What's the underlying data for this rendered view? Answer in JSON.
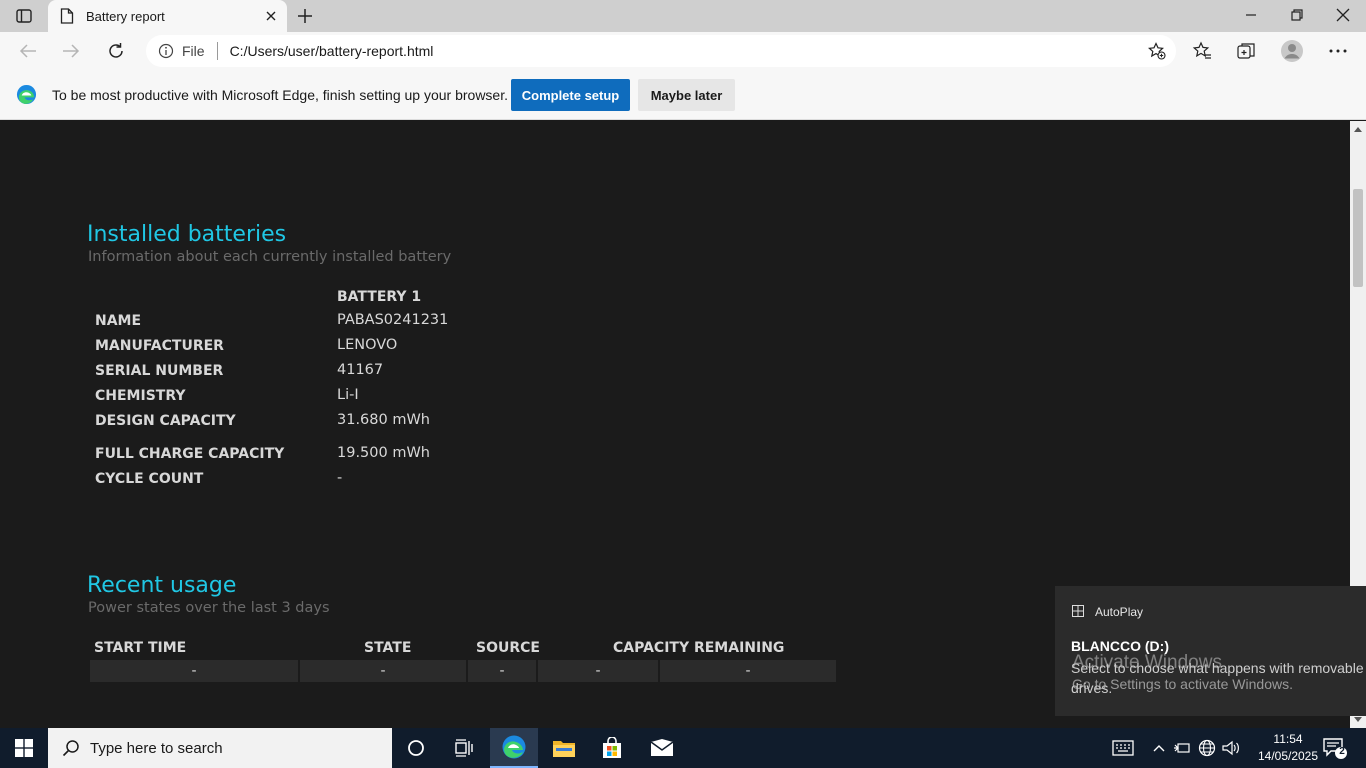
{
  "browser": {
    "tab_title": "Battery report",
    "address_scheme": "File",
    "url": "C:/Users/user/battery-report.html"
  },
  "infobar": {
    "message": "To be most productive with Microsoft Edge, finish setting up your browser.",
    "primary_button": "Complete setup",
    "secondary_button": "Maybe later"
  },
  "installed": {
    "heading": "Installed batteries",
    "subheading": "Information about each currently installed battery",
    "column_header": "BATTERY 1",
    "rows": [
      {
        "label": "NAME",
        "value": "PABAS0241231"
      },
      {
        "label": "MANUFACTURER",
        "value": "LENOVO"
      },
      {
        "label": "SERIAL NUMBER",
        "value": "41167"
      },
      {
        "label": "CHEMISTRY",
        "value": "Li-I"
      },
      {
        "label": "DESIGN CAPACITY",
        "value": "31.680 mWh"
      },
      {
        "label": "FULL CHARGE CAPACITY",
        "value": "19.500 mWh"
      },
      {
        "label": "CYCLE COUNT",
        "value": "-"
      }
    ]
  },
  "recent": {
    "heading": "Recent usage",
    "subheading": "Power states over the last 3 days",
    "columns": [
      "START TIME",
      "STATE",
      "SOURCE",
      "CAPACITY REMAINING"
    ],
    "row": [
      "-",
      "-",
      "-",
      "-",
      "-"
    ]
  },
  "toast": {
    "app": "AutoPlay",
    "title": "BLANCCO (D:)",
    "body_line1": "Select to choose what happens with removable",
    "body_line2": "drives."
  },
  "watermark": {
    "title": "Activate Windows",
    "subtitle": "Go to Settings to activate Windows."
  },
  "taskbar": {
    "search_placeholder": "Type here to search",
    "time": "11:54",
    "date": "14/05/2025",
    "notification_count": "2"
  },
  "colors": {
    "heading": "#20c7e4",
    "content_bg": "#1b1b1b",
    "primary_button": "#0f6cbd",
    "taskbar": "#101c2c"
  }
}
